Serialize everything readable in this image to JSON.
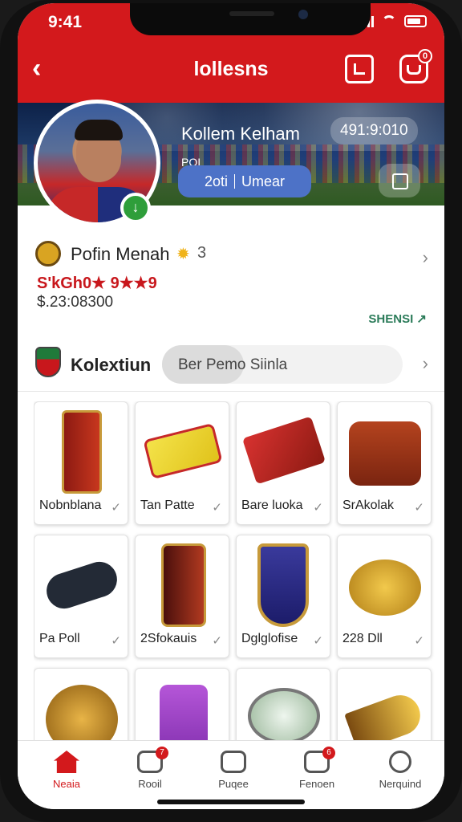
{
  "status": {
    "time": "9:41"
  },
  "header": {
    "back": "‹",
    "title": "lollesns",
    "badge": "0"
  },
  "banner": {
    "player_name": "Kollem Kelham",
    "player_id": "491:9:010",
    "sub": "POI",
    "pill_left": "2oti",
    "pill_right": "Umear"
  },
  "profile": {
    "name": "Pofin Menah",
    "num": "3",
    "rating": "S'kGh0★ 9★★9",
    "balance": "$.23:08300",
    "link": "SHENSI ↗"
  },
  "collection": {
    "title": "Kolextiun",
    "search_value": "Ber Pemo Siinla"
  },
  "items": [
    {
      "label": "Nobnblana",
      "art": "red-folder"
    },
    {
      "label": "Tan Patte",
      "art": "yellow-ticket"
    },
    {
      "label": "Bare luoka",
      "art": "red-box"
    },
    {
      "label": "SrAkolak",
      "art": "leather-bag"
    },
    {
      "label": "Pa Poll",
      "art": "bracelet"
    },
    {
      "label": "2Sfokauis",
      "art": "card-holder"
    },
    {
      "label": "Dglglofise",
      "art": "shield-badge"
    },
    {
      "label": "228 Dll",
      "art": "gold-coins"
    },
    {
      "label": "",
      "art": "gold-ball"
    },
    {
      "label": "",
      "art": "purple-case"
    },
    {
      "label": "",
      "art": "glass-disc"
    },
    {
      "label": "",
      "art": "gold-horn"
    }
  ],
  "tabbar": [
    {
      "label": "Neaia",
      "icon": "home-icon",
      "badge": ""
    },
    {
      "label": "Rooil",
      "icon": "chat-icon",
      "badge": "7"
    },
    {
      "label": "Puqee",
      "icon": "message-icon",
      "badge": ""
    },
    {
      "label": "Fenoen",
      "icon": "inbox-icon",
      "badge": "6"
    },
    {
      "label": "Nerquind",
      "icon": "profile-icon",
      "badge": ""
    }
  ],
  "colors": {
    "brand_red": "#d3191c",
    "accent_blue": "#4d72c7",
    "link_green": "#2c7c5a"
  }
}
